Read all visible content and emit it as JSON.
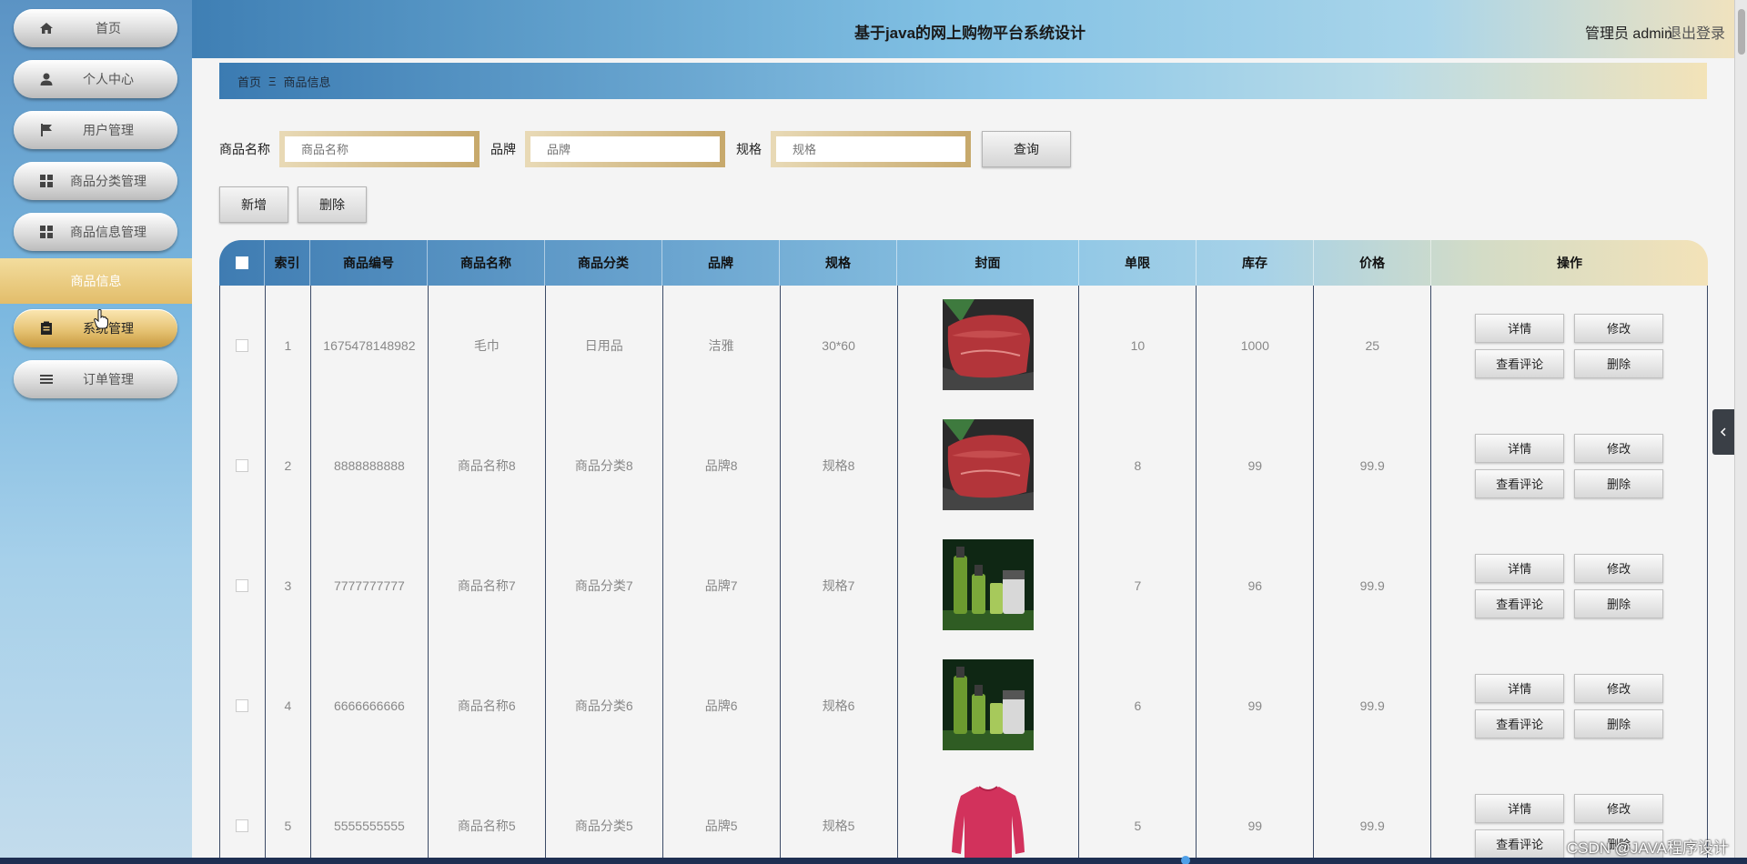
{
  "header": {
    "title": "基于java的网上购物平台系统设计",
    "admin": "管理员 admin",
    "logout": "退出登录"
  },
  "sidebar": {
    "items": [
      {
        "label": "首页",
        "icon": "home-icon"
      },
      {
        "label": "个人中心",
        "icon": "user-icon"
      },
      {
        "label": "用户管理",
        "icon": "flag-icon"
      },
      {
        "label": "商品分类管理",
        "icon": "grid-icon"
      },
      {
        "label": "商品信息管理",
        "icon": "grid-icon"
      },
      {
        "label": "系统管理",
        "icon": "clipboard-icon"
      },
      {
        "label": "订单管理",
        "icon": "list-icon"
      }
    ],
    "sub_item": "商品信息"
  },
  "breadcrumb": {
    "home": "首页",
    "sep": "Ξ",
    "current": "商品信息"
  },
  "search": {
    "name_label": "商品名称",
    "name_placeholder": "商品名称",
    "brand_label": "品牌",
    "brand_placeholder": "品牌",
    "spec_label": "规格",
    "spec_placeholder": "规格",
    "search_btn": "查询"
  },
  "actions": {
    "add": "新增",
    "delete": "删除"
  },
  "table": {
    "headers": [
      "索引",
      "商品编号",
      "商品名称",
      "商品分类",
      "品牌",
      "规格",
      "封面",
      "单限",
      "库存",
      "价格",
      "操作"
    ],
    "rows": [
      {
        "idx": "1",
        "code": "1675478148982",
        "name": "毛巾",
        "cat": "日用品",
        "brand": "洁雅",
        "spec": "30*60",
        "cover": "meat",
        "limit": "10",
        "stock": "1000",
        "price": "25"
      },
      {
        "idx": "2",
        "code": "8888888888",
        "name": "商品名称8",
        "cat": "商品分类8",
        "brand": "品牌8",
        "spec": "规格8",
        "cover": "meat",
        "limit": "8",
        "stock": "99",
        "price": "99.9"
      },
      {
        "idx": "3",
        "code": "7777777777",
        "name": "商品名称7",
        "cat": "商品分类7",
        "brand": "品牌7",
        "spec": "规格7",
        "cover": "cosmetics",
        "limit": "7",
        "stock": "96",
        "price": "99.9"
      },
      {
        "idx": "4",
        "code": "6666666666",
        "name": "商品名称6",
        "cat": "商品分类6",
        "brand": "品牌6",
        "spec": "规格6",
        "cover": "cosmetics",
        "limit": "6",
        "stock": "99",
        "price": "99.9"
      },
      {
        "idx": "5",
        "code": "5555555555",
        "name": "商品名称5",
        "cat": "商品分类5",
        "brand": "品牌5",
        "spec": "规格5",
        "cover": "sweater",
        "limit": "5",
        "stock": "99",
        "price": "99.9"
      }
    ],
    "ops": {
      "detail": "详情",
      "edit": "修改",
      "comments": "查看评论",
      "delete": "删除"
    }
  },
  "watermark": "CSDN @JAVA程序设计"
}
